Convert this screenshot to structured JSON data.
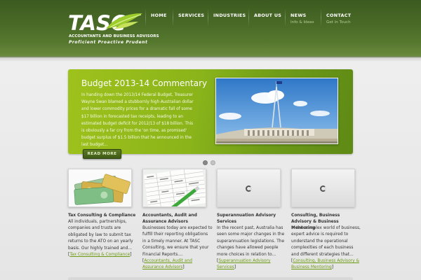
{
  "brand": {
    "logo_text": "TASC",
    "tagline_line1": "ACCOUNTANTS AND BUSINESS ADVISORS",
    "tagline_line2": "Proficient Proactive Prudent"
  },
  "nav": [
    {
      "label": "HOME",
      "sub": ""
    },
    {
      "label": "SERVICES",
      "sub": ""
    },
    {
      "label": "INDUSTRIES",
      "sub": ""
    },
    {
      "label": "ABOUT US",
      "sub": ""
    },
    {
      "label": "NEWS",
      "sub": "Info & Ideas"
    },
    {
      "label": "CONTACT",
      "sub": "Get in Touch"
    }
  ],
  "hero": {
    "title": "Budget 2013-14 Commentary",
    "body": "In handing down the 2013/14 Federal Budget, Treasurer Wayne Swan blamed a stubbornly high Australian dollar and lower commodity prices for a dramatic fall of some $17 billion in forecasted tax receipts, leading to an estimated budget deficit for 2012/13 of $18 billion. This is obviously a far cry from the 'on time, as promised' budget surplus of $1.5 billion that he announced in the last budget...",
    "button": "READ MORE",
    "image_icon": "parliament-house-photo"
  },
  "slider": {
    "total": 2,
    "active": 1
  },
  "services": [
    {
      "title": "Tax Consulting & Compliance",
      "text": "All individuals, partnerships, companies and trusts are obligated by law to submit tax returns to the ATO on an yearly basis. Our highly trained and...",
      "link": "Tax Consulting & Compliance",
      "thumb": "banknotes-photo"
    },
    {
      "title": "Accountants, Audit and Assurance Advisors",
      "text": "Businesses today are expected to fulfill their reporting obligations in a timely manner. At TASC Consulting, we ensure that your Financial Reports....",
      "link": "Accountants, Audit and Assurance Advisors",
      "thumb": "spreadsheet-pen-photo"
    },
    {
      "title": "Superannuation Advisory Services",
      "text": "In the recent past, Australia has seen some major changes in the superannuation legislations. The changes have allowed people more choices in relation to...",
      "link": "Superannuation Advisory Services",
      "thumb": "loading-spinner"
    },
    {
      "title": "Consulting, Business Advisory & Business Mentoring",
      "text": "In the complex world of business, expert advice is required to understand the operational complexities of each business and different strategies that...",
      "link": "Consulting, Business Advisory & Business Mentoring",
      "thumb": "loading-spinner"
    }
  ],
  "colors": {
    "accent": "#8ab41a",
    "header": "#4a6b27",
    "link": "#6d9a13"
  }
}
